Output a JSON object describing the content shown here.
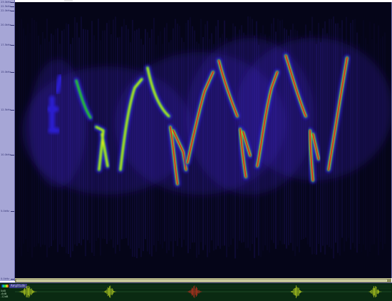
{
  "freq_axis": {
    "ticks": [
      {
        "label": "23.0kHz",
        "value": 23.0
      },
      {
        "label": "22.5kHz",
        "value": 22.5
      },
      {
        "label": "22.0kHz",
        "value": 22.0
      },
      {
        "label": "20.0kHz",
        "value": 20.0
      },
      {
        "label": "17.5kHz",
        "value": 17.5
      },
      {
        "label": "15.0kHz",
        "value": 15.0
      },
      {
        "label": "12.5kHz",
        "value": 12.5
      },
      {
        "label": "10.0kHz",
        "value": 10.0
      },
      {
        "label": "5.0kHz",
        "value": 5.0
      },
      {
        "label": "0.0kHz",
        "value": 0.0
      }
    ]
  },
  "waveform_panel": {
    "label": "Amplitude",
    "db_labels": [
      "0dB",
      "-6dB",
      "-12dB"
    ]
  },
  "colors": {
    "background": "#050518",
    "low": "#2a1ad0",
    "mid": "#20d020",
    "high": "#e8e820",
    "peak": "#e02020",
    "waveform": "#c8e020"
  }
}
